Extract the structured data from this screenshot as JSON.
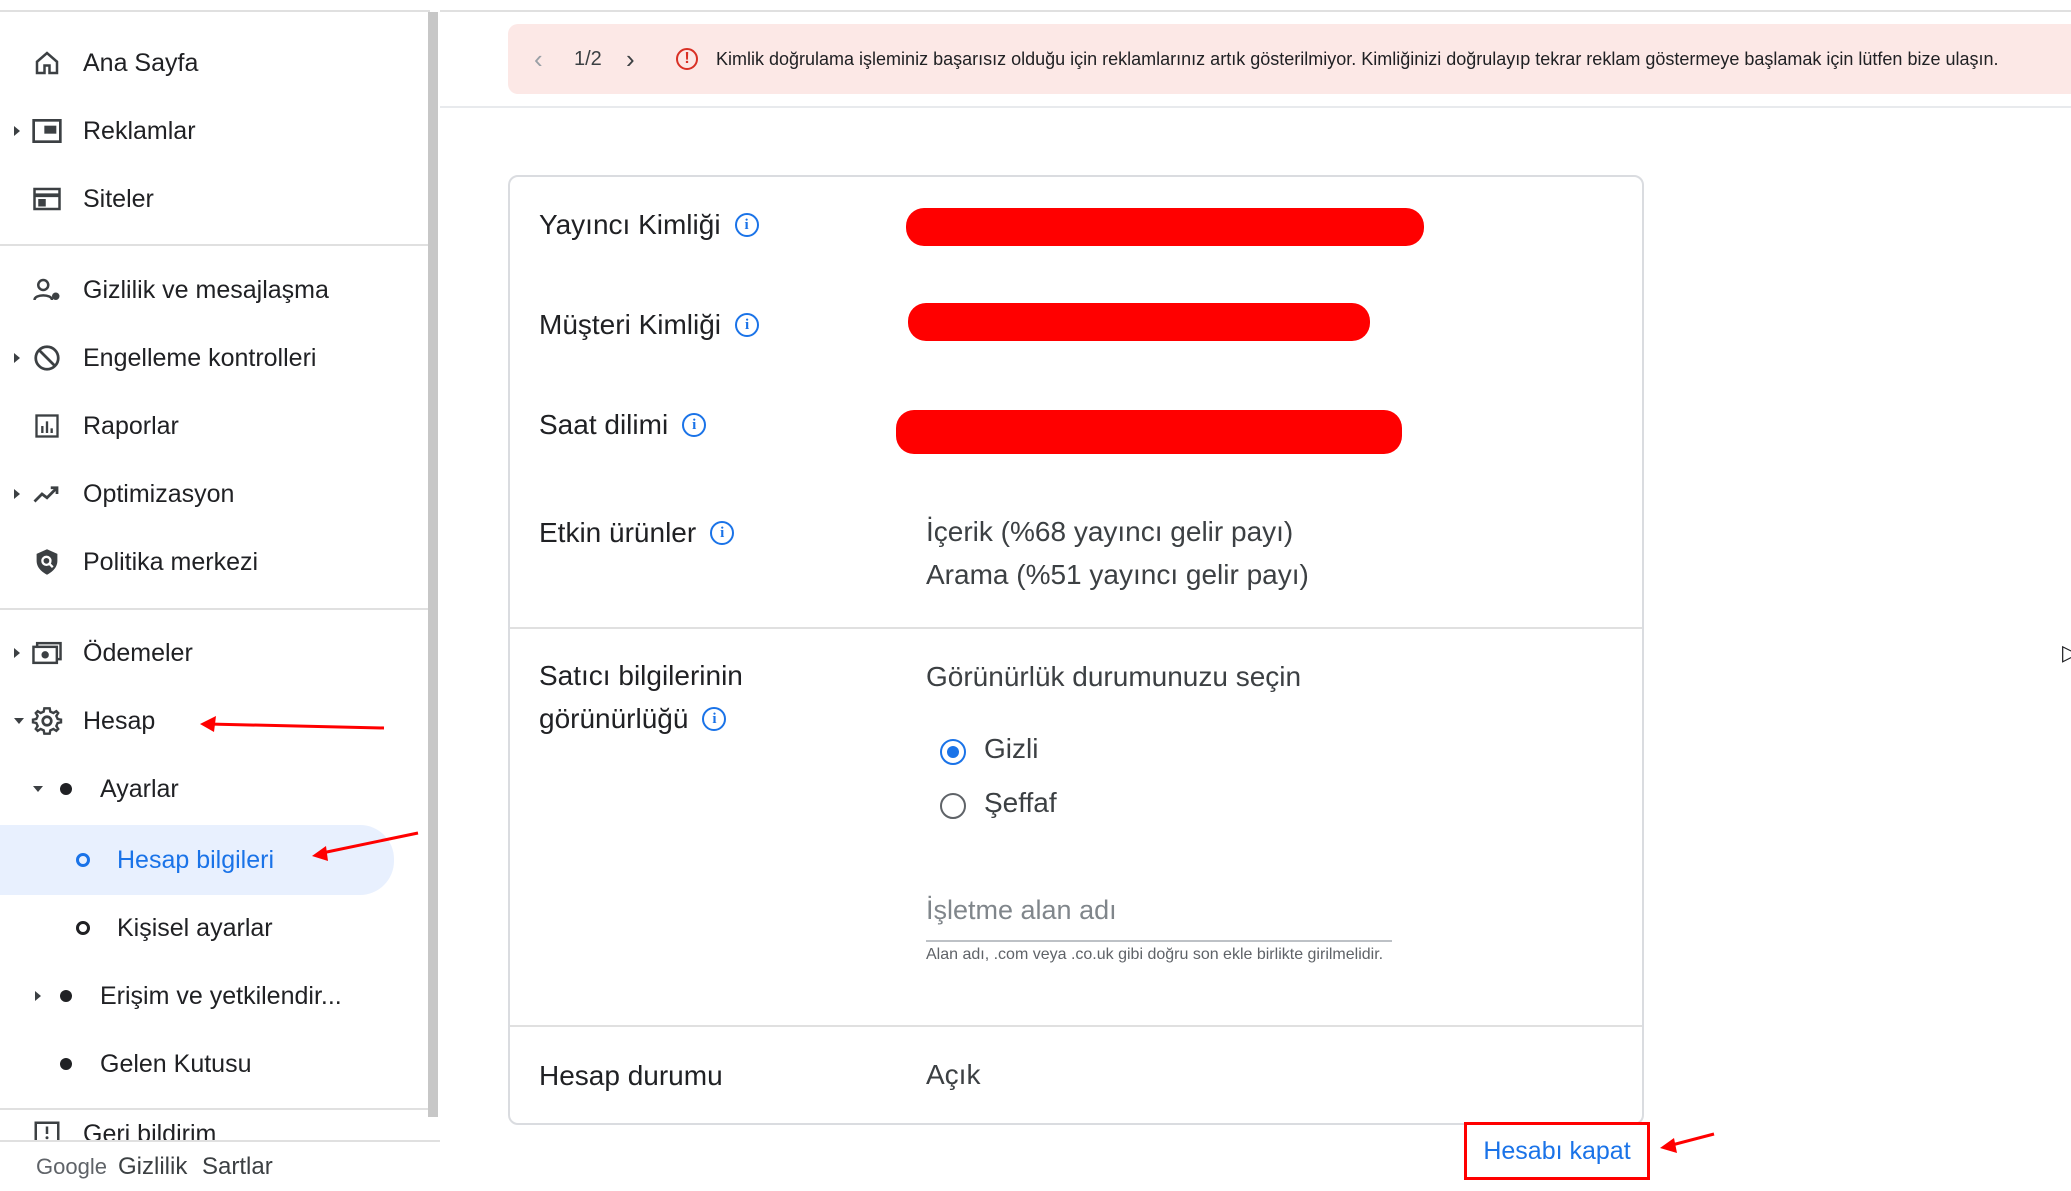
{
  "sidebar": {
    "items": [
      {
        "label": "Ana Sayfa",
        "icon": "home-icon"
      },
      {
        "label": "Reklamlar",
        "icon": "ads-icon"
      },
      {
        "label": "Siteler",
        "icon": "sites-icon"
      },
      {
        "label": "Gizlilik ve mesajlaşma",
        "icon": "privacy-icon"
      },
      {
        "label": "Engelleme kontrolleri",
        "icon": "block-icon"
      },
      {
        "label": "Raporlar",
        "icon": "reports-icon"
      },
      {
        "label": "Optimizasyon",
        "icon": "trending-icon"
      },
      {
        "label": "Politika merkezi",
        "icon": "policy-shield-icon"
      },
      {
        "label": "Ödemeler",
        "icon": "payments-icon"
      },
      {
        "label": "Hesap",
        "icon": "gear-icon"
      },
      {
        "label": "Ayarlar"
      },
      {
        "label": "Hesap bilgileri"
      },
      {
        "label": "Kişisel ayarlar"
      },
      {
        "label": "Erişim ve yetkilendir..."
      },
      {
        "label": "Gelen Kutusu"
      },
      {
        "label": "Geri bildirim",
        "icon": "feedback-icon"
      }
    ],
    "footer": {
      "brand": "Google",
      "privacy": "Gizlilik",
      "terms": "Sartlar"
    }
  },
  "banner": {
    "page": "1/2",
    "message": "Kimlik doğrulama işleminiz başarısız olduğu için reklamlarınız artık gösterilmiyor. Kimliğinizi doğrulayıp tekrar reklam göstermeye başlamak için lütfen bize ulaşın.",
    "color": "#fce8e6"
  },
  "account": {
    "publisher_id_label": "Yayıncı Kimliği",
    "customer_id_label": "Müşteri Kimliği",
    "timezone_label": "Saat dilimi",
    "products_label": "Etkin ürünler",
    "products": [
      "İçerik (%68 yayıncı gelir payı)",
      "Arama (%51 yayıncı gelir payı)"
    ],
    "seller_label_1": "Satıcı bilgilerinin",
    "seller_label_2": "görünürlüğü",
    "visibility_prompt": "Görünürlük durumunuzu seçin",
    "option_hidden": "Gizli",
    "option_transparent": "Şeffaf",
    "selected_option": "Gizli",
    "domain_placeholder": "İşletme alan adı",
    "domain_hint": "Alan adı, .com veya .co.uk gibi doğru son ekle birlikte girilmelidir.",
    "status_label": "Hesap durumu",
    "status_value": "Açık",
    "close_account": "Hesabı kapat"
  },
  "colors": {
    "accent": "#1a73e8",
    "annotation": "#ff0000",
    "active_bg": "#e8f0fe"
  }
}
